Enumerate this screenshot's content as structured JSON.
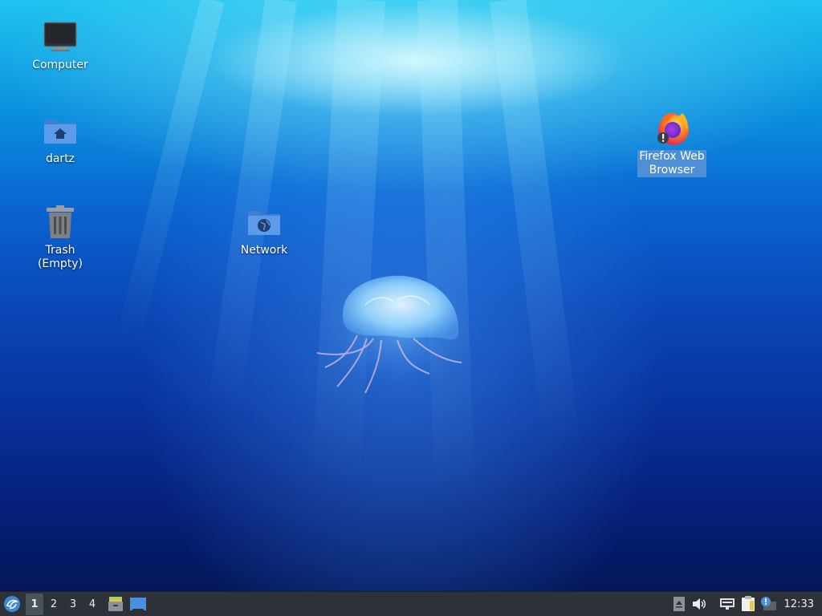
{
  "desktop": {
    "icons": {
      "computer": {
        "label": "Computer",
        "icon": "computer-icon"
      },
      "home": {
        "label": "dartz",
        "icon": "home-folder-icon"
      },
      "trash": {
        "label": "Trash (Empty)",
        "icon": "trash-icon"
      },
      "network": {
        "label": "Network",
        "icon": "network-folder-icon"
      },
      "firefox": {
        "label_line1": "Firefox Web",
        "label_line2": "Browser",
        "icon": "firefox-icon",
        "selected": true
      }
    },
    "wallpaper": "jellyfish-underwater",
    "colors": {
      "selection": "#4f8fd6",
      "water_top": "#1ec3ef",
      "water_bottom": "#041659"
    }
  },
  "taskbar": {
    "start_icon": "lubuntu-menu-icon",
    "workspaces": [
      {
        "label": "1",
        "active": true
      },
      {
        "label": "2",
        "active": false
      },
      {
        "label": "3",
        "active": false
      },
      {
        "label": "4",
        "active": false
      }
    ],
    "quicklaunch": [
      "file-manager-icon",
      "show-desktop-icon"
    ],
    "tray": [
      "tray-arrow-icon",
      "volume-icon",
      "network-status-icon",
      "clipboard-icon",
      "update-notifier-icon"
    ],
    "clock": "12:33",
    "colors": {
      "background": "#2c3238"
    }
  }
}
